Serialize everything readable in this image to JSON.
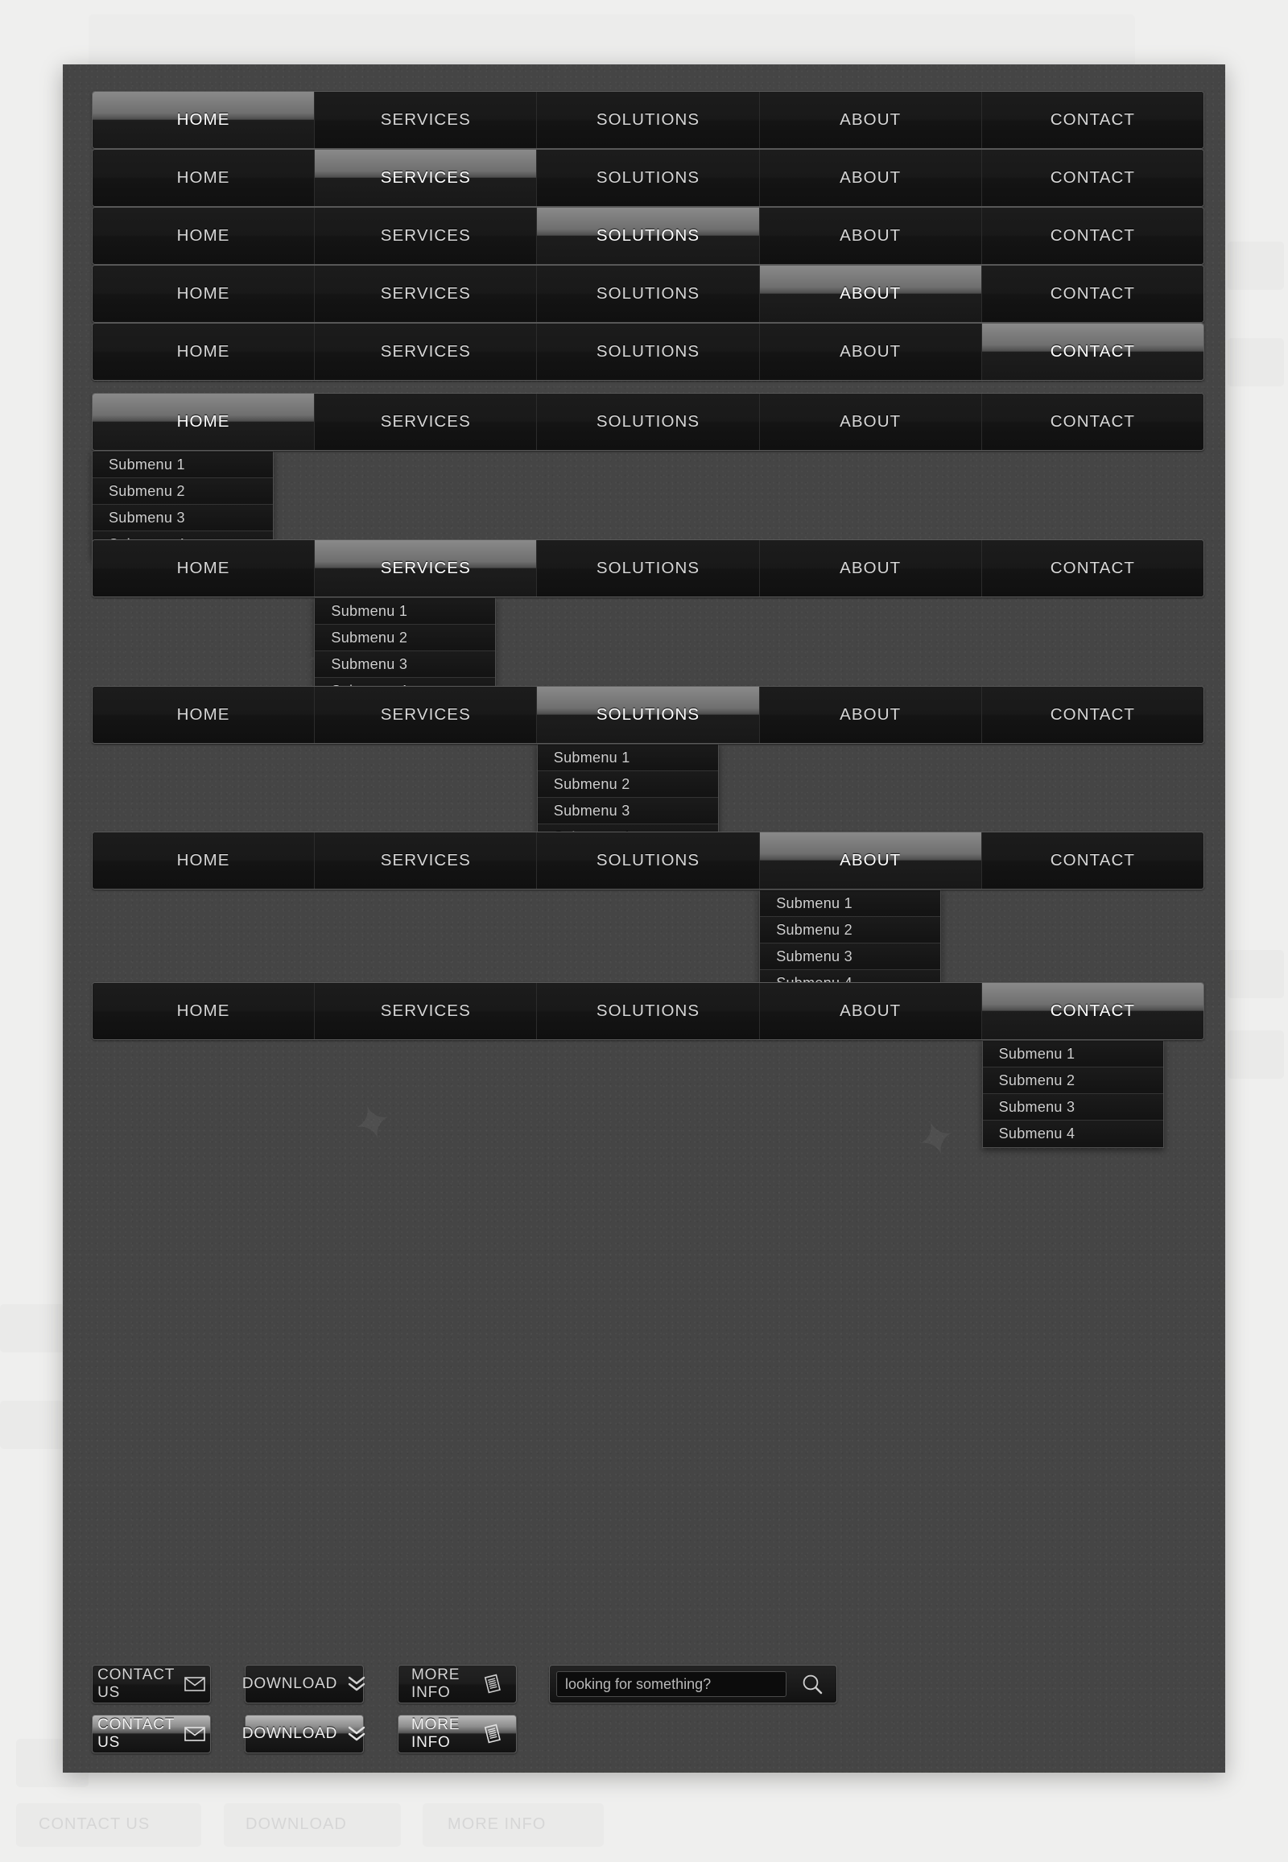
{
  "nav": {
    "items": [
      "HOME",
      "SERVICES",
      "SOLUTIONS",
      "ABOUT",
      "CONTACT"
    ]
  },
  "submenu": {
    "items": [
      "Submenu 1",
      "Submenu 2",
      "Submenu 3",
      "Submenu 4"
    ]
  },
  "rows": [
    {
      "active": 0,
      "dropdown": false
    },
    {
      "active": 1,
      "dropdown": false
    },
    {
      "active": 2,
      "dropdown": false
    },
    {
      "active": 3,
      "dropdown": false
    },
    {
      "active": 4,
      "dropdown": false
    },
    {
      "active": 0,
      "dropdown": true
    },
    {
      "active": 1,
      "dropdown": true
    },
    {
      "active": 2,
      "dropdown": true
    },
    {
      "active": 3,
      "dropdown": true
    },
    {
      "active": 4,
      "dropdown": true
    }
  ],
  "buttons": {
    "contact": {
      "label": "CONTACT US",
      "icon": "envelope-icon"
    },
    "download": {
      "label": "DOWNLOAD",
      "icon": "double-chevron-down-icon"
    },
    "more": {
      "label": "MORE INFO",
      "icon": "document-icon"
    }
  },
  "search": {
    "placeholder": "looking for something?",
    "value": "",
    "icon": "search-icon"
  },
  "colors": {
    "panel_bg": "#454545",
    "item_bg": "#151515",
    "active_highlight": "#8a8a8a",
    "text": "#d7d7d7",
    "page_bg": "#efefee"
  }
}
